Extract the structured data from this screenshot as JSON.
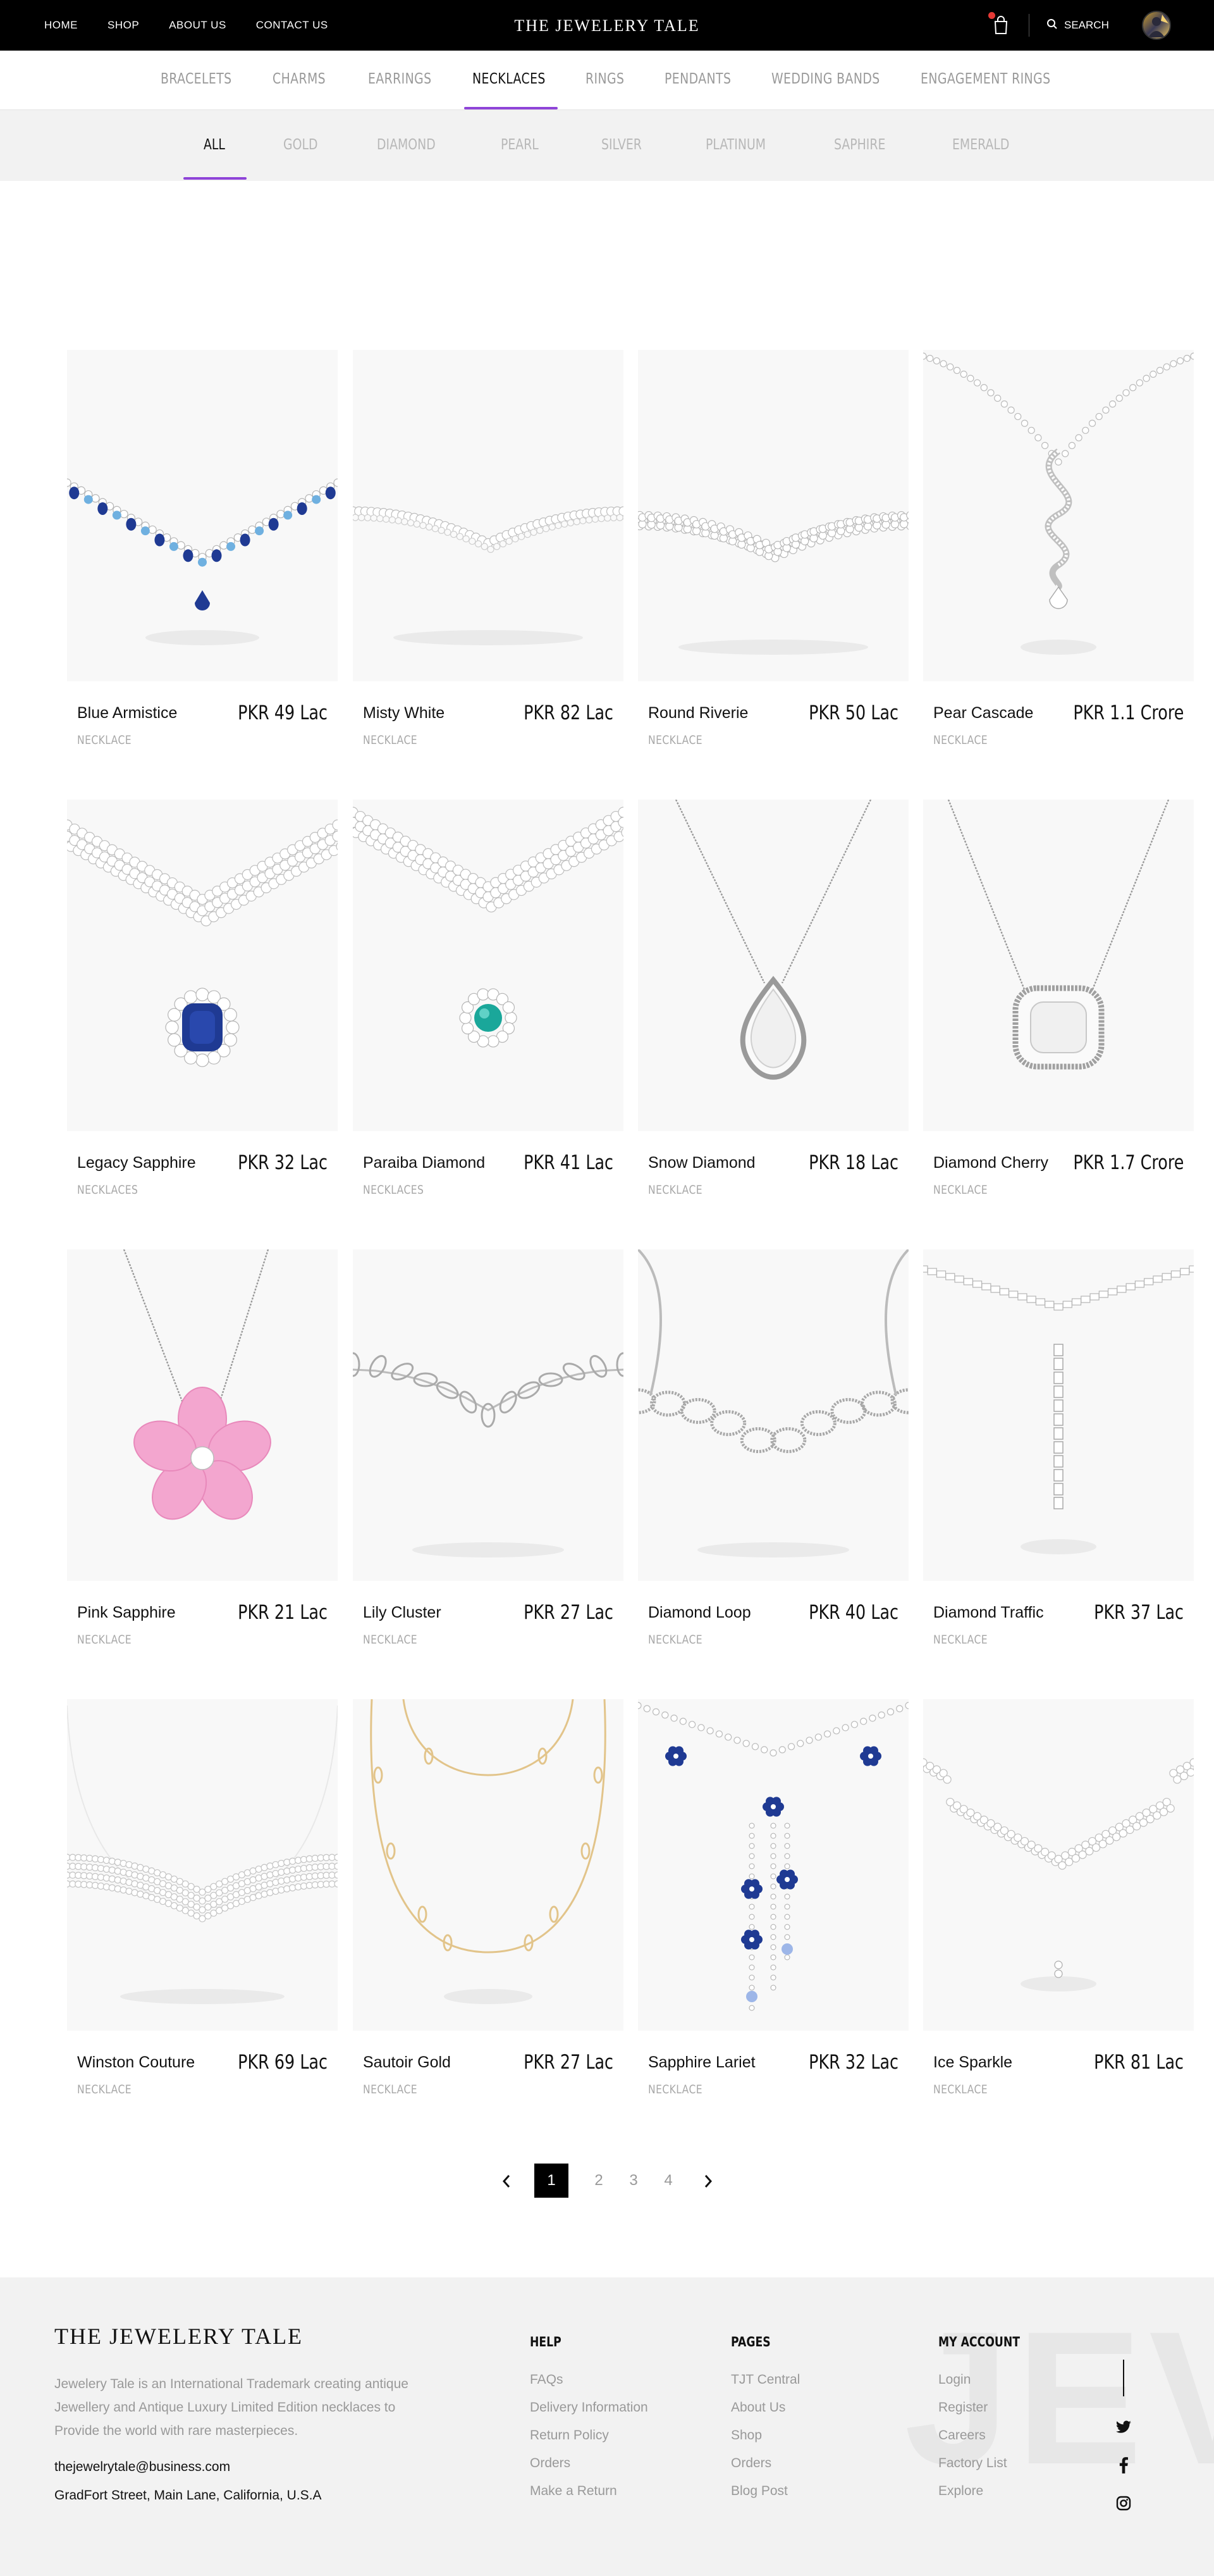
{
  "header": {
    "nav": [
      "HOME",
      "SHOP",
      "ABOUT US",
      "CONTACT US"
    ],
    "brand": "THE JEWELERY TALE",
    "search_label": "SEARCH"
  },
  "categories": {
    "items": [
      "BRACELETS",
      "CHARMS",
      "EARRINGS",
      "NECKLACES",
      "RINGS",
      "PENDANTS",
      "WEDDING BANDS",
      "ENGAGEMENT RINGS"
    ],
    "active": "NECKLACES"
  },
  "filters": {
    "items": [
      "ALL",
      "GOLD",
      "DIAMOND",
      "PEARL",
      "SILVER",
      "PLATINUM",
      "SAPHIRE",
      "EMERALD"
    ],
    "active": "ALL"
  },
  "products": [
    {
      "name": "Blue Armistice",
      "price": "PKR 49 Lac",
      "category": "NECKLACE",
      "style": "sapphire-v"
    },
    {
      "name": "Misty White",
      "price": "PKR 82 Lac",
      "category": "NECKLACE",
      "style": "diamond-arc"
    },
    {
      "name": "Round Riverie",
      "price": "PKR 50 Lac",
      "category": "NECKLACE",
      "style": "cluster-arc"
    },
    {
      "name": "Pear Cascade",
      "price": "PKR 1.1 Crore",
      "category": "NECKLACE",
      "style": "cascade"
    },
    {
      "name": "Legacy Sapphire",
      "price": "PKR 32 Lac",
      "category": "NECKLACES",
      "style": "bib-blue"
    },
    {
      "name": "Paraiba Diamond",
      "price": "PKR 41 Lac",
      "category": "NECKLACES",
      "style": "bib-teal"
    },
    {
      "name": "Snow Diamond",
      "price": "PKR 18 Lac",
      "category": "NECKLACE",
      "style": "pear-pendant"
    },
    {
      "name": "Diamond Cherry",
      "price": "PKR 1.7 Crore",
      "category": "NECKLACE",
      "style": "cushion-pendant"
    },
    {
      "name": "Pink Sapphire",
      "price": "PKR 21 Lac",
      "category": "NECKLACE",
      "style": "pink-flower"
    },
    {
      "name": "Lily Cluster",
      "price": "PKR 27 Lac",
      "category": "NECKLACE",
      "style": "leaf-chain"
    },
    {
      "name": "Diamond Loop",
      "price": "PKR 40 Lac",
      "category": "NECKLACE",
      "style": "loop-chain"
    },
    {
      "name": "Diamond Traffic",
      "price": "PKR 37 Lac",
      "category": "NECKLACE",
      "style": "y-drop"
    },
    {
      "name": "Winston Couture",
      "price": "PKR 69 Lac",
      "category": "NECKLACE",
      "style": "wide-collar"
    },
    {
      "name": "Sautoir Gold",
      "price": "PKR 27 Lac",
      "category": "NECKLACE",
      "style": "gold-sautoir"
    },
    {
      "name": "Sapphire Lariet",
      "price": "PKR 32 Lac",
      "category": "NECKLACE",
      "style": "blue-lariat"
    },
    {
      "name": "Ice Sparkle",
      "price": "PKR 81 Lac",
      "category": "NECKLACE",
      "style": "ice-v"
    }
  ],
  "pagination": {
    "pages": [
      "1",
      "2",
      "3",
      "4"
    ],
    "current": "1"
  },
  "footer": {
    "brand": "THE JEWELERY TALE",
    "description": "Jewelery Tale is an International Trademark creating antique Jewellery and Antique Luxury Limited Edition necklaces to Provide the world with rare masterpieces.",
    "email": "thejewelrytale@business.com",
    "address": "GradFort Street, Main Lane, California, U.S.A",
    "watermark": "JEV",
    "help": {
      "title": "HELP",
      "links": [
        "FAQs",
        "Delivery Information",
        "Return Policy",
        "Orders",
        "Make a Return"
      ]
    },
    "pages": {
      "title": "PAGES",
      "links": [
        "TJT Central",
        "About Us",
        "Shop",
        "Orders",
        "Blog Post"
      ]
    },
    "account": {
      "title": "MY ACCOUNT",
      "links": [
        "Login",
        "Register",
        "Careers",
        "Factory List",
        "Explore"
      ]
    },
    "social_icons": [
      "twitter-icon",
      "facebook-icon",
      "instagram-icon"
    ]
  },
  "colors": {
    "accent": "#8e44d8",
    "header_bg": "#000000",
    "footer_bg": "#f2f2f2",
    "card_bg": "#f8f8f8",
    "sapphire": "#1f3a93",
    "teal": "#1aa79a",
    "pink": "#f3a6cf",
    "gold": "#e2c48a"
  }
}
